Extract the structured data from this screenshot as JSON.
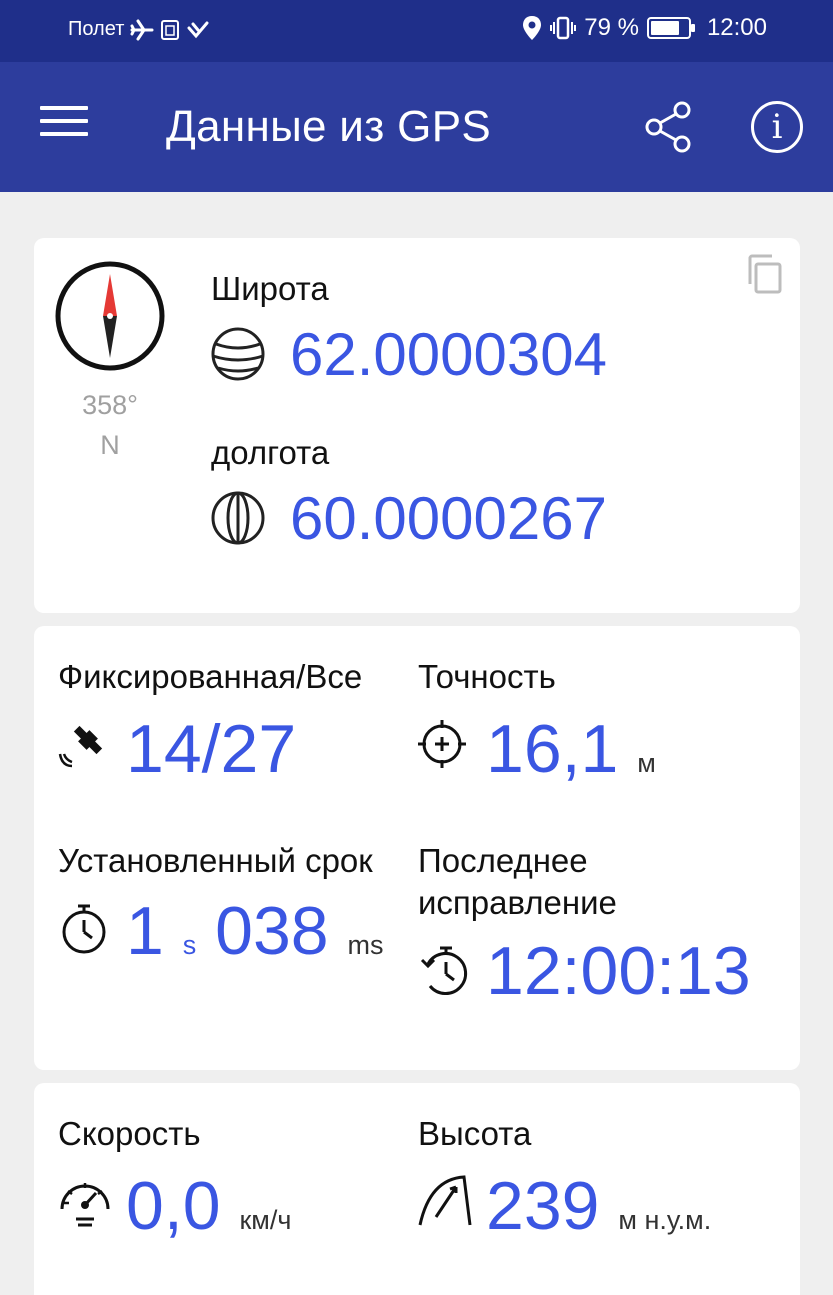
{
  "status_bar": {
    "airplane_mode_label": "Полет",
    "battery_text": "79 %",
    "battery_level": 0.79,
    "time": "12:00",
    "icons": [
      "airplane-icon",
      "sim-icon",
      "vpn-icon",
      "location-icon",
      "vibrate-icon",
      "battery-icon"
    ]
  },
  "app_bar": {
    "title": "Данные из GPS",
    "icons": [
      "menu-icon",
      "share-icon",
      "info-icon"
    ]
  },
  "coordinates": {
    "heading_degrees": "358°",
    "heading_direction": "N",
    "latitude_label": "Широта",
    "latitude_value": "62.0000304",
    "longitude_label": "долгота",
    "longitude_value": "60.0000267"
  },
  "fix": {
    "satellites_label": "Фиксированная/Все",
    "satellites_value": "14/27",
    "accuracy_label": "Точность",
    "accuracy_value": "16,1",
    "accuracy_unit": "м",
    "ttf_label": "Установленный срок",
    "ttf_seconds": "1",
    "ttf_seconds_unit": "s",
    "ttf_ms": "038",
    "ttf_ms_unit": "ms",
    "last_fix_label_line1": "Последнее",
    "last_fix_label_line2": "исправление",
    "last_fix_value": "12:00:13"
  },
  "motion": {
    "speed_label": "Скорость",
    "speed_value": "0,0",
    "speed_unit": "км/ч",
    "altitude_label": "Высота",
    "altitude_value": "239",
    "altitude_unit": "м н.у.м."
  },
  "colors": {
    "status_bar": "#1f2f8a",
    "app_bar": "#2d3d9d",
    "accent_value": "#3a56e2",
    "compass_needle": "#e53935"
  }
}
